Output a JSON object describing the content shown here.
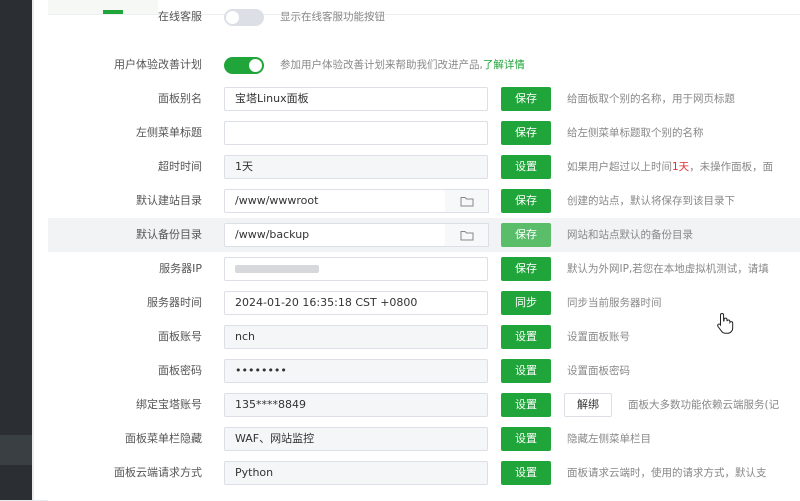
{
  "settings": {
    "rows": [
      {
        "id": "online-service",
        "label": "在线客服",
        "type": "toggle",
        "on": false,
        "hint": "显示在线客服功能按钮"
      },
      {
        "id": "ux-plan",
        "label": "用户体验改善计划",
        "type": "toggle",
        "on": true,
        "hint": "参加用户体验改善计划来帮助我们改进产品,",
        "link": "了解详情"
      },
      {
        "id": "panel-alias",
        "label": "面板别名",
        "type": "input",
        "value": "宝塔Linux面板",
        "button": "保存",
        "hint": "给面板取个别的名称，用于网页标题"
      },
      {
        "id": "left-menu-title",
        "label": "左侧菜单标题",
        "type": "input",
        "value": "",
        "button": "保存",
        "hint": "给左侧菜单标题取个别的名称"
      },
      {
        "id": "timeout",
        "label": "超时时间",
        "type": "readonly",
        "value": "1天",
        "button": "设置",
        "hint_pre": "如果用户超过以上时间",
        "hint_red": "1天",
        "hint_post": "，未操作面板，面"
      },
      {
        "id": "default-site-dir",
        "label": "默认建站目录",
        "type": "path",
        "value": "/www/wwwroot",
        "button": "保存",
        "hint": "创建的站点，默认将保存到该目录下"
      },
      {
        "id": "default-backup-dir",
        "label": "默认备份目录",
        "type": "path",
        "value": "/www/backup",
        "button": "保存",
        "hint": "网站和站点默认的备份目录"
      },
      {
        "id": "server-ip",
        "label": "服务器IP",
        "type": "input",
        "value": "",
        "button": "保存",
        "hint": "默认为外网IP,若您在本地虚拟机测试，请填"
      },
      {
        "id": "server-time",
        "label": "服务器时间",
        "type": "input",
        "value": "2024-01-20 16:35:18 CST +0800",
        "button": "同步",
        "hint": "同步当前服务器时间"
      },
      {
        "id": "panel-account",
        "label": "面板账号",
        "type": "readonly",
        "value": "nch",
        "button": "设置",
        "hint": "设置面板账号"
      },
      {
        "id": "panel-password",
        "label": "面板密码",
        "type": "readonly",
        "value": "••••••••",
        "button": "设置",
        "hint": "设置面板密码"
      },
      {
        "id": "bt-account",
        "label": "绑定宝塔账号",
        "type": "readonly",
        "value": "135****8849",
        "button": "设置",
        "button2": "解绑",
        "hint": "面板大多数功能依赖云端服务(记"
      },
      {
        "id": "menu-hide",
        "label": "面板菜单栏隐藏",
        "type": "readonly",
        "value": "WAF、网站监控",
        "button": "设置",
        "hint": "隐藏左侧菜单栏目"
      },
      {
        "id": "cloud-method",
        "label": "面板云端请求方式",
        "type": "readonly",
        "value": "Python",
        "button": "设置",
        "hint": "面板请求云端时，使用的请求方式，默认支"
      }
    ]
  },
  "colors": {
    "accent": "#20a53a",
    "accent_light": "#59bd6a",
    "danger": "#e22e2e"
  },
  "icons": {
    "folder": "folder-icon",
    "cursor": "hand-cursor-icon"
  }
}
